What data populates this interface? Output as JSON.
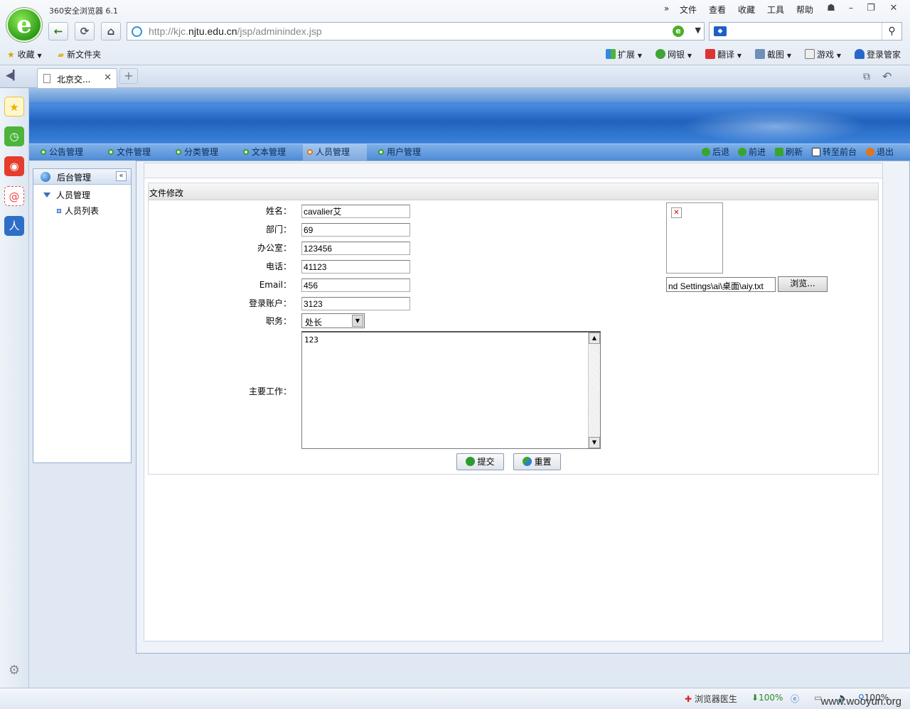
{
  "browser": {
    "title": "360安全浏览器 6.1",
    "menu": [
      "»",
      "文件",
      "查看",
      "收藏",
      "工具",
      "帮助"
    ],
    "window_buttons": [
      "skin-icon",
      "minimize-icon",
      "restore-icon",
      "close-icon"
    ],
    "url_prefix": "http://kjc.",
    "url_domain": "njtu.edu.cn",
    "url_path": "/jsp/adminindex.jsp",
    "favorites_label": "收藏",
    "new_folder_label": "新文件夹",
    "toolbar": [
      "扩展",
      "网银",
      "翻译",
      "截图",
      "游戏",
      "登录管家"
    ],
    "tab_label": "北京交...",
    "new_tab_label": "+",
    "status": {
      "doctor": "浏览器医生",
      "download": "100%",
      "zoom": "100%"
    },
    "watermark": "www.wooyun.org"
  },
  "page": {
    "nav": [
      {
        "label": "公告管理",
        "active": false
      },
      {
        "label": "文件管理",
        "active": false
      },
      {
        "label": "分类管理",
        "active": false
      },
      {
        "label": "文本管理",
        "active": false
      },
      {
        "label": "人员管理",
        "active": true
      },
      {
        "label": "用户管理",
        "active": false
      }
    ],
    "nav_right": [
      "后退",
      "前进",
      "刷新",
      "转至前台",
      "退出"
    ],
    "tree": {
      "header": "后台管理",
      "collapse_label": "«",
      "group": "人员管理",
      "leaf": "人员列表"
    },
    "form": {
      "title": "文件修改",
      "fields": {
        "name": {
          "label": "姓名：",
          "value": "cavalier艾"
        },
        "dept": {
          "label": "部门：",
          "value": "69"
        },
        "office": {
          "label": "办公室：",
          "value": "123456"
        },
        "phone": {
          "label": "电话：",
          "value": "41123"
        },
        "email": {
          "label": "Email：",
          "value": "456"
        },
        "account": {
          "label": "登录账户：",
          "value": "3123"
        },
        "duty": {
          "label": "职务：",
          "value": "处长"
        },
        "work": {
          "label": "主要工作：",
          "value": "123"
        }
      },
      "file_path": "nd Settings\\ai\\桌面\\aiy.txt",
      "browse_label": "浏览...",
      "submit_label": "提交",
      "reset_label": "重置"
    }
  },
  "colors": {
    "banner": "#2d6ec2",
    "nav_bar": "#5f99dc",
    "active_dot": "#d77a17",
    "dot": "#3c9c2a"
  }
}
